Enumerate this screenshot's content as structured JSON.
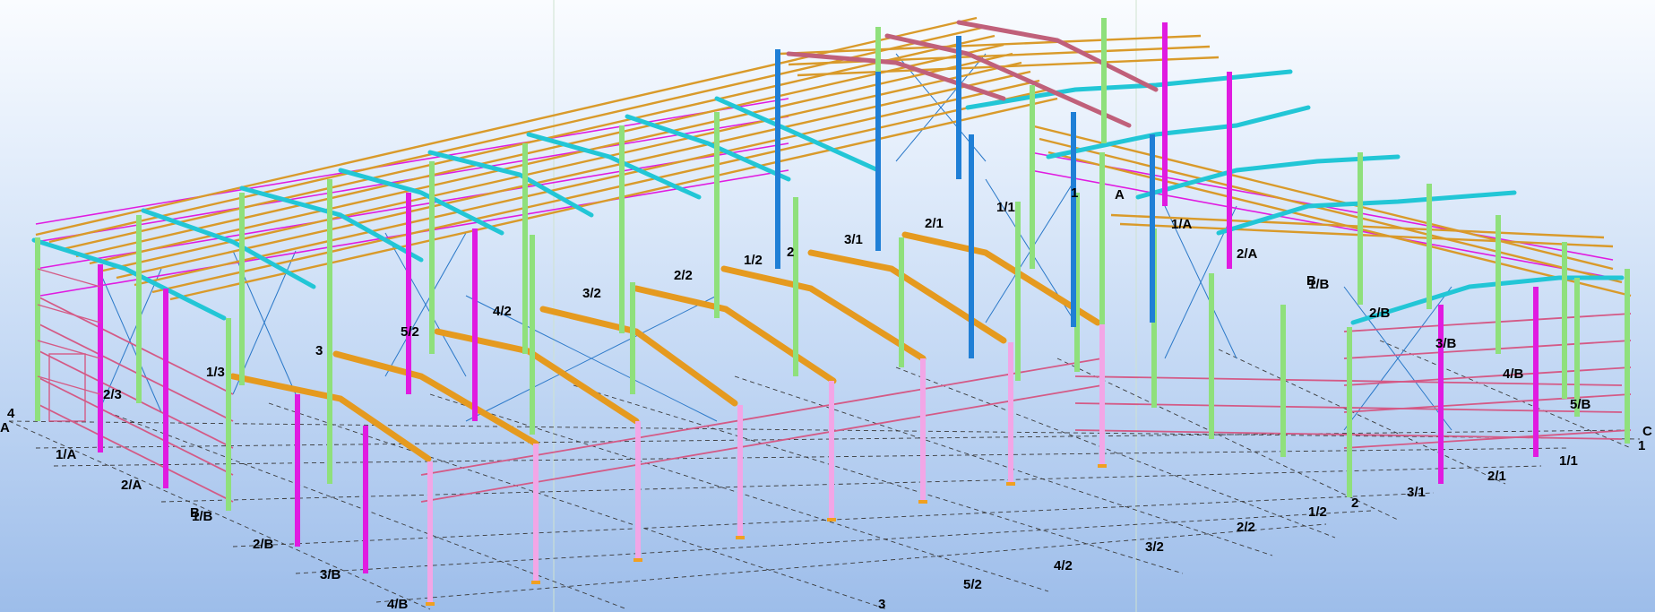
{
  "colors": {
    "rafter": "#e59a1f",
    "purlin": "#d99a2a",
    "column_green": "#8fe07c",
    "column_magenta": "#e01be0",
    "column_blue": "#1f7fd6",
    "column_pink": "#f2a6e6",
    "rail": "#d45a86",
    "eaves": "#22c6d6",
    "brace": "#2a78c8",
    "grid": "#3a3a3a",
    "truss_maroon": "#c0607a"
  },
  "frame_labels": {
    "f_1_3": "1/3",
    "f_3": "3",
    "f_5_2": "5/2",
    "f_4_2": "4/2",
    "f_3_2": "3/2",
    "f_2_2": "2/2",
    "f_1_2": "1/2",
    "f_2": "2",
    "f_3_1": "3/1",
    "f_2_1": "2/1",
    "f_1_1": "1/1",
    "f_1": "1",
    "f_a": "A",
    "f_1_a": "1/A",
    "f_2_a": "2/A",
    "f_b": "B",
    "f_1_b": "1/B",
    "f_2_b": "2/B",
    "f_3_b": "3/B",
    "f_4_b": "4/B",
    "f_5_b": "5/B",
    "f_2_3": "2/3"
  },
  "grid_labels": {
    "g_4": "4",
    "g_a": "A",
    "g_1_a": "1/A",
    "g_2_a": "2/A",
    "g_b": "B",
    "g_1_b": "1/B",
    "g_2_b": "2/B",
    "g_3_b": "3/B",
    "g_4_b": "4/B",
    "g_3": "3",
    "g_5_2": "5/2",
    "g_4_2": "4/2",
    "g_3_2": "3/2",
    "g_2_2": "2/2",
    "g_1_2": "1/2",
    "g_2": "2",
    "g_3_1": "3/1",
    "g_2_1": "2/1",
    "g_1_1": "1/1",
    "g_c": "C",
    "g_1": "1"
  }
}
